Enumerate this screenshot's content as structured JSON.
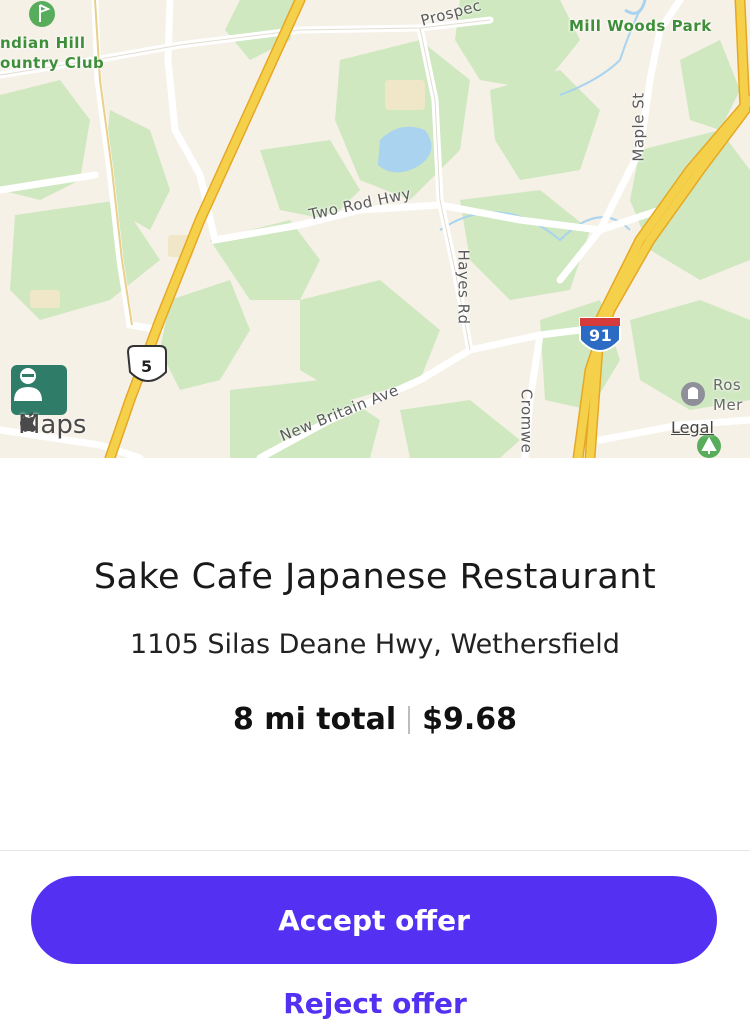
{
  "map": {
    "labels": {
      "country_club": "Indian Hill\nCountry Club",
      "country_club_line1": "ndian Hill",
      "country_club_line2": "ountry Club",
      "prospect": "Prospec",
      "mill_woods_park": "Mill Woods Park",
      "maple_st": "Maple St",
      "two_rod_hwy": "Two Rod Hwy",
      "hayes_rd": "Hayes Rd",
      "new_britain_ave": "New Britain Ave",
      "cromwell": "Cromwe",
      "route_5": "5",
      "interstate_91": "91",
      "rose_line1": "Ros",
      "rose_line2": "Mer"
    },
    "maps_logo": "Maps",
    "legal": "Legal",
    "colors": {
      "background": "#f6f1e7",
      "park": "#cfe8c0",
      "highway": "#f5c842",
      "water": "#a9d3ef",
      "pin": "#2f7d68"
    },
    "icons": [
      "apple-icon",
      "driver-pin-icon",
      "golf-icon",
      "cemetery-icon",
      "tree-icon"
    ]
  },
  "offer": {
    "restaurant_name": "Sake Cafe Japanese Restaurant",
    "address": "1105 Silas Deane Hwy, Wethersfield",
    "distance": "8 mi total",
    "pay": "$9.68"
  },
  "actions": {
    "accept_label": "Accept offer",
    "reject_label": "Reject offer"
  },
  "colors": {
    "accent": "#5330f2"
  }
}
